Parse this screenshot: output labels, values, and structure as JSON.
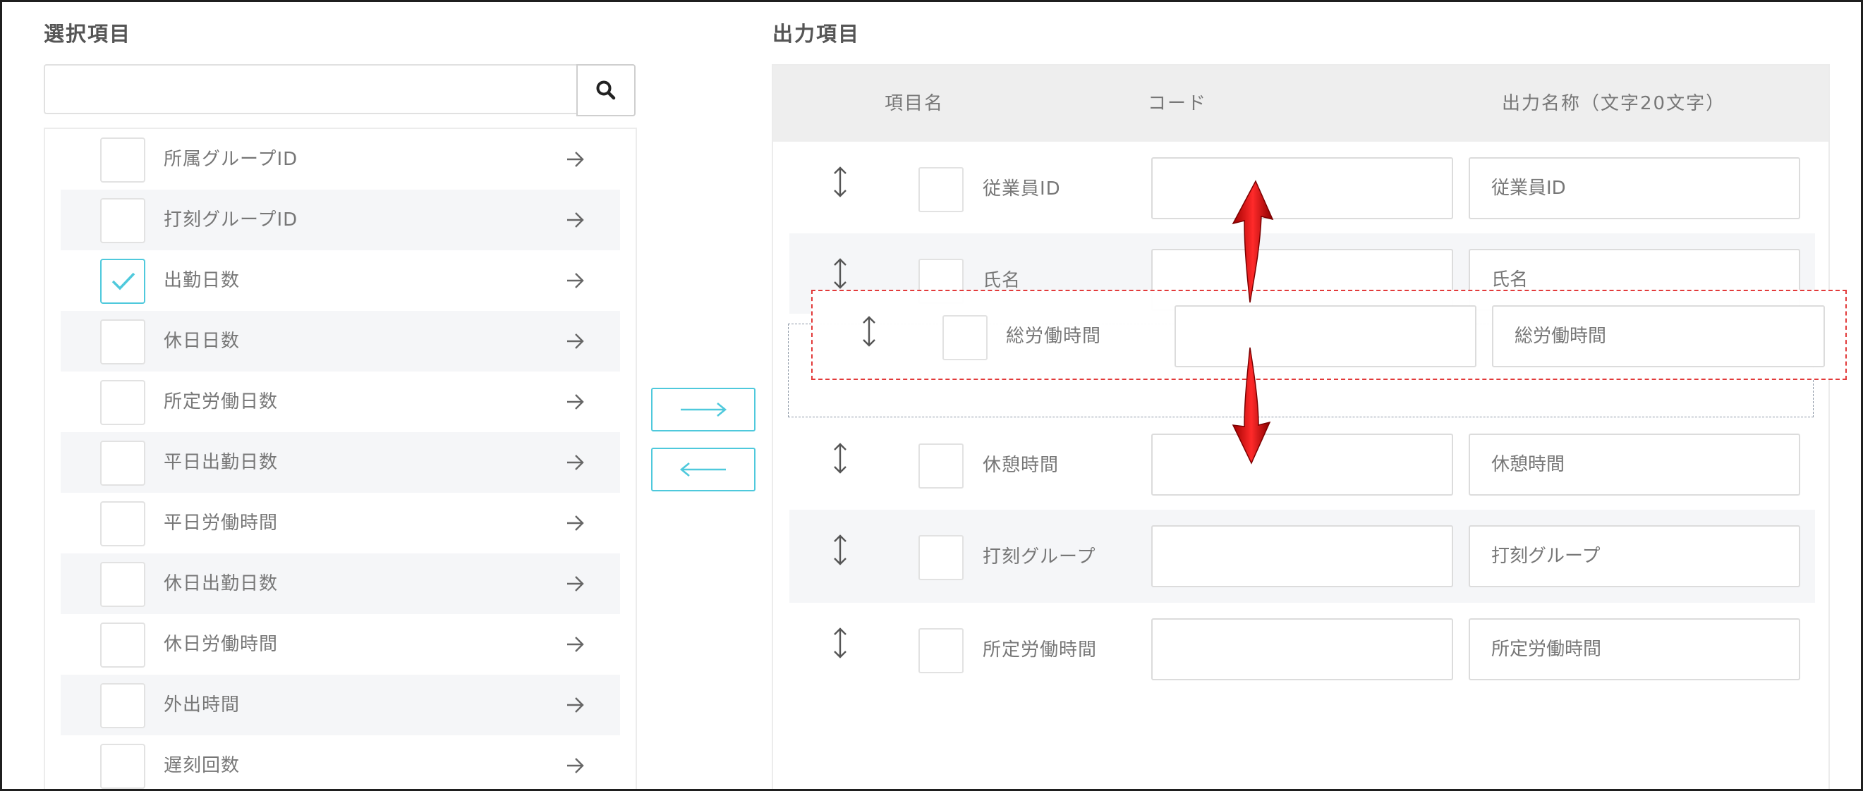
{
  "left": {
    "title": "選択項目",
    "search": {
      "value": "",
      "placeholder": ""
    },
    "items": [
      {
        "label": "所属グループID",
        "checked": false
      },
      {
        "label": "打刻グループID",
        "checked": false
      },
      {
        "label": "出勤日数",
        "checked": true
      },
      {
        "label": "休日日数",
        "checked": false
      },
      {
        "label": "所定労働日数",
        "checked": false
      },
      {
        "label": "平日出勤日数",
        "checked": false
      },
      {
        "label": "平日労働時間",
        "checked": false
      },
      {
        "label": "休日出勤日数",
        "checked": false
      },
      {
        "label": "休日労働時間",
        "checked": false
      },
      {
        "label": "外出時間",
        "checked": false
      },
      {
        "label": "遅刻回数",
        "checked": false
      }
    ]
  },
  "move_buttons": {
    "add_icon": "arrow-right-icon",
    "remove_icon": "arrow-left-icon"
  },
  "right": {
    "title": "出力項目",
    "headers": {
      "item_name": "項目名",
      "code": "コード",
      "output_name": "出力名称（文字20文字）"
    },
    "rows": [
      {
        "label": "従業員ID",
        "code": "",
        "output_name": "従業員ID"
      },
      {
        "label": "氏名",
        "code": "",
        "output_name": "氏名"
      },
      {
        "label": "休憩時間",
        "code": "",
        "output_name": "休憩時間"
      },
      {
        "label": "打刻グループ",
        "code": "",
        "output_name": "打刻グループ"
      },
      {
        "label": "所定労働時間",
        "code": "",
        "output_name": "所定労働時間"
      }
    ],
    "dragging_row": {
      "label": "総労働時間",
      "code": "",
      "output_name": "総労働時間"
    }
  },
  "colors": {
    "accent": "#4fc9dc",
    "drag_highlight": "#e23a3a",
    "row_alt": "#f5f6f8",
    "header_bg": "#eeeeee"
  }
}
